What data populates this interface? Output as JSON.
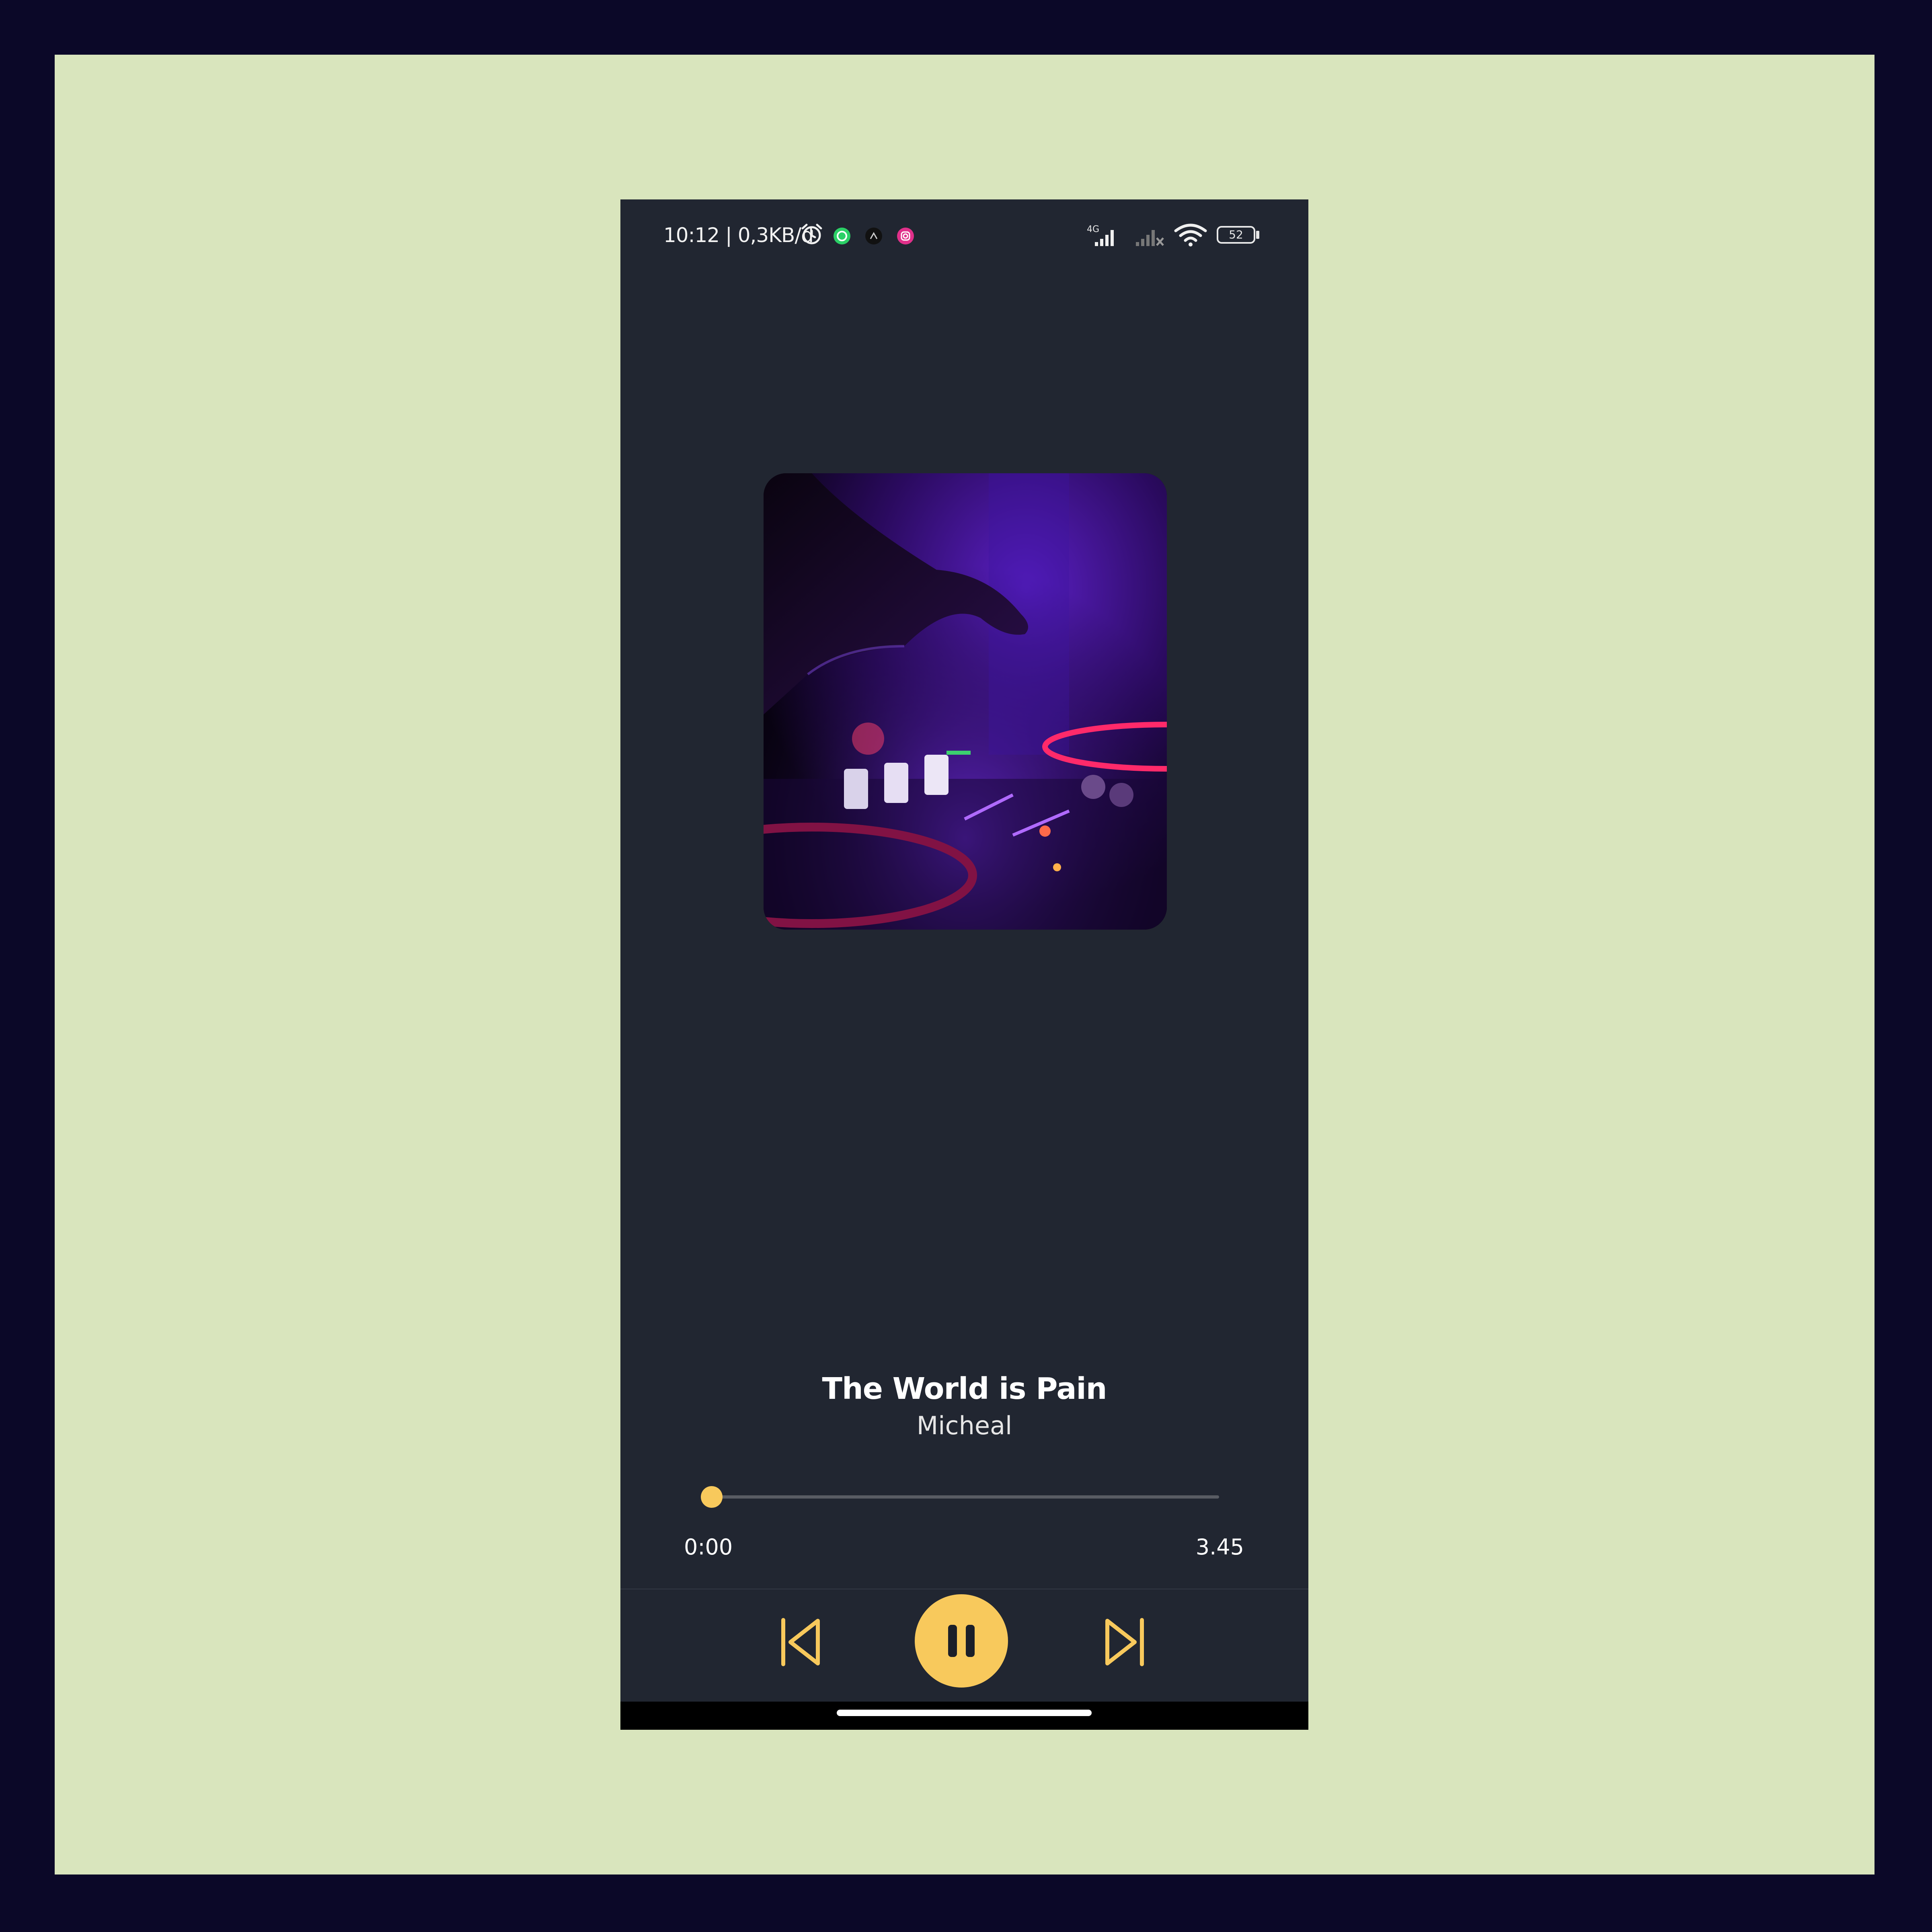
{
  "status_bar": {
    "text": "10:12 | 0,3KB/d",
    "network_label": "4G",
    "battery": "52",
    "icons": [
      "alarm-icon",
      "whatsapp-icon",
      "app-icon",
      "instagram-icon",
      "signal-icon",
      "signal-off-icon",
      "wifi-icon",
      "battery-icon"
    ]
  },
  "album": {
    "art_description_icon": "album-art-image"
  },
  "track": {
    "title": "The World is Pain",
    "artist": "Micheal"
  },
  "progress": {
    "current": "0:00",
    "total": "3.45",
    "fraction": 0.0
  },
  "controls": {
    "icons": [
      "skip-previous-icon",
      "pause-icon",
      "skip-next-icon"
    ]
  },
  "actions": {
    "icons": [
      "heart-icon",
      "repeat-icon",
      "share-icon",
      "more-icon"
    ]
  },
  "colors": {
    "background": "#212631",
    "accent": "#f8c95c",
    "frame": "#d9e5bd",
    "outer": "#0b0828"
  }
}
